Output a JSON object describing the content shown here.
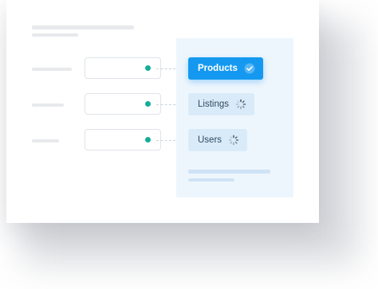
{
  "colors": {
    "accent": "#1599f0",
    "connector_dot": "#13ad9a",
    "panel_background": "#eef6fd",
    "pending_chip": "#d9ebf9"
  },
  "mappings": [
    {
      "target_label": "Products",
      "status": "complete",
      "status_icon": "check-circle-icon"
    },
    {
      "target_label": "Listings",
      "status": "loading",
      "status_icon": "spinner-icon"
    },
    {
      "target_label": "Users",
      "status": "loading",
      "status_icon": "spinner-icon"
    }
  ]
}
